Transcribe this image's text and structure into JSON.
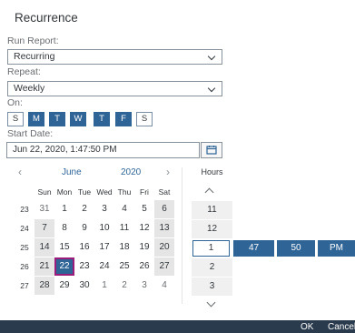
{
  "dialog": {
    "title": "Recurrence"
  },
  "run_report": {
    "label": "Run Report:",
    "value": "Recurring"
  },
  "repeat": {
    "label": "Repeat:",
    "value": "Weekly"
  },
  "on": {
    "label": "On:",
    "days": [
      {
        "label": "S",
        "selected": false
      },
      {
        "label": "M",
        "selected": true
      },
      {
        "label": "T",
        "selected": true
      },
      {
        "label": "W",
        "selected": true
      },
      {
        "label": "T",
        "selected": true
      },
      {
        "label": "F",
        "selected": true
      },
      {
        "label": "S",
        "selected": false
      }
    ]
  },
  "start_date": {
    "label": "Start Date:",
    "value": "Jun 22, 2020, 1:47:50 PM"
  },
  "calendar": {
    "month": "June",
    "year": "2020",
    "weekdays": [
      "Sun",
      "Mon",
      "Tue",
      "Wed",
      "Thu",
      "Fri",
      "Sat"
    ],
    "weeks": [
      {
        "week": "23",
        "days": [
          "31",
          "1",
          "2",
          "3",
          "4",
          "5",
          "6"
        ]
      },
      {
        "week": "24",
        "days": [
          "7",
          "8",
          "9",
          "10",
          "11",
          "12",
          "13"
        ]
      },
      {
        "week": "25",
        "days": [
          "14",
          "15",
          "16",
          "17",
          "18",
          "19",
          "20"
        ]
      },
      {
        "week": "26",
        "days": [
          "21",
          "22",
          "23",
          "24",
          "25",
          "26",
          "27"
        ]
      },
      {
        "week": "27",
        "days": [
          "28",
          "29",
          "30",
          "1",
          "2",
          "3",
          "4"
        ]
      }
    ],
    "selected_day": "22"
  },
  "time": {
    "hours_label": "Hours",
    "hours": [
      "11",
      "12",
      "1",
      "2",
      "3"
    ],
    "selected_hour": "1",
    "minutes": "47",
    "seconds": "50",
    "period": "PM"
  },
  "footer": {
    "ok": "OK",
    "cancel": "Cancel"
  },
  "colors": {
    "accent": "#2f6497",
    "footer": "#2a3b4d",
    "selected_outline": "#9b1c7a"
  }
}
